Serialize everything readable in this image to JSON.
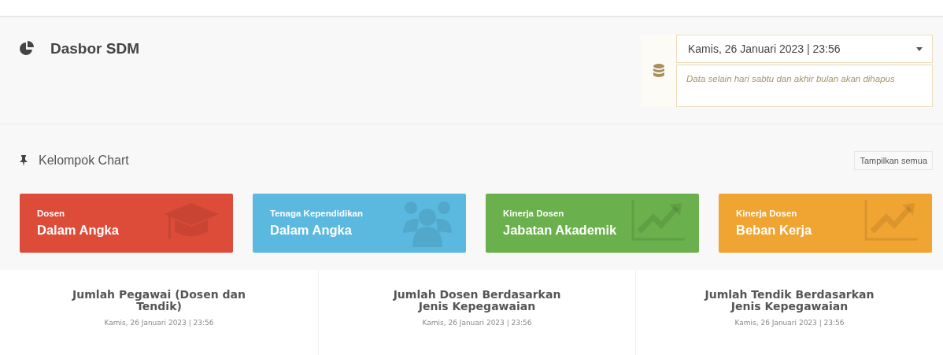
{
  "header": {
    "title": "Dasbor SDM",
    "date_select": {
      "value": "Kamis, 26 Januari 2023 | 23:56"
    },
    "note": "Data selain hari sabtu dan akhir bulan akan dihapus"
  },
  "group": {
    "title": "Kelompok Chart",
    "button": "Tampilkan semua"
  },
  "cards": [
    {
      "subtitle": "Dosen",
      "title": "Dalam Angka",
      "color": "#dd4b39",
      "kind": "graduation"
    },
    {
      "subtitle": "Tenaga Kependidikan",
      "title": "Dalam Angka",
      "color": "#5bb9e0",
      "kind": "users"
    },
    {
      "subtitle": "Kinerja Dosen",
      "title": "Jabatan Akademik",
      "color": "#6ab04c",
      "kind": "chart"
    },
    {
      "subtitle": "Kinerja Dosen",
      "title": "Beban Kerja",
      "color": "#f0a432",
      "kind": "chart"
    }
  ],
  "panels": [
    {
      "title": "Jumlah Pegawai (Dosen dan Tendik)",
      "date": "Kamis, 26 Januari 2023 | 23:56"
    },
    {
      "title": "Jumlah Dosen Berdasarkan Jenis Kepegawaian",
      "date": "Kamis, 26 Januari 2023 | 23:56"
    },
    {
      "title": "Jumlah Tendik Berdasarkan Jenis Kepegawaian",
      "date": "Kamis, 26 Januari 2023 | 23:56"
    }
  ]
}
